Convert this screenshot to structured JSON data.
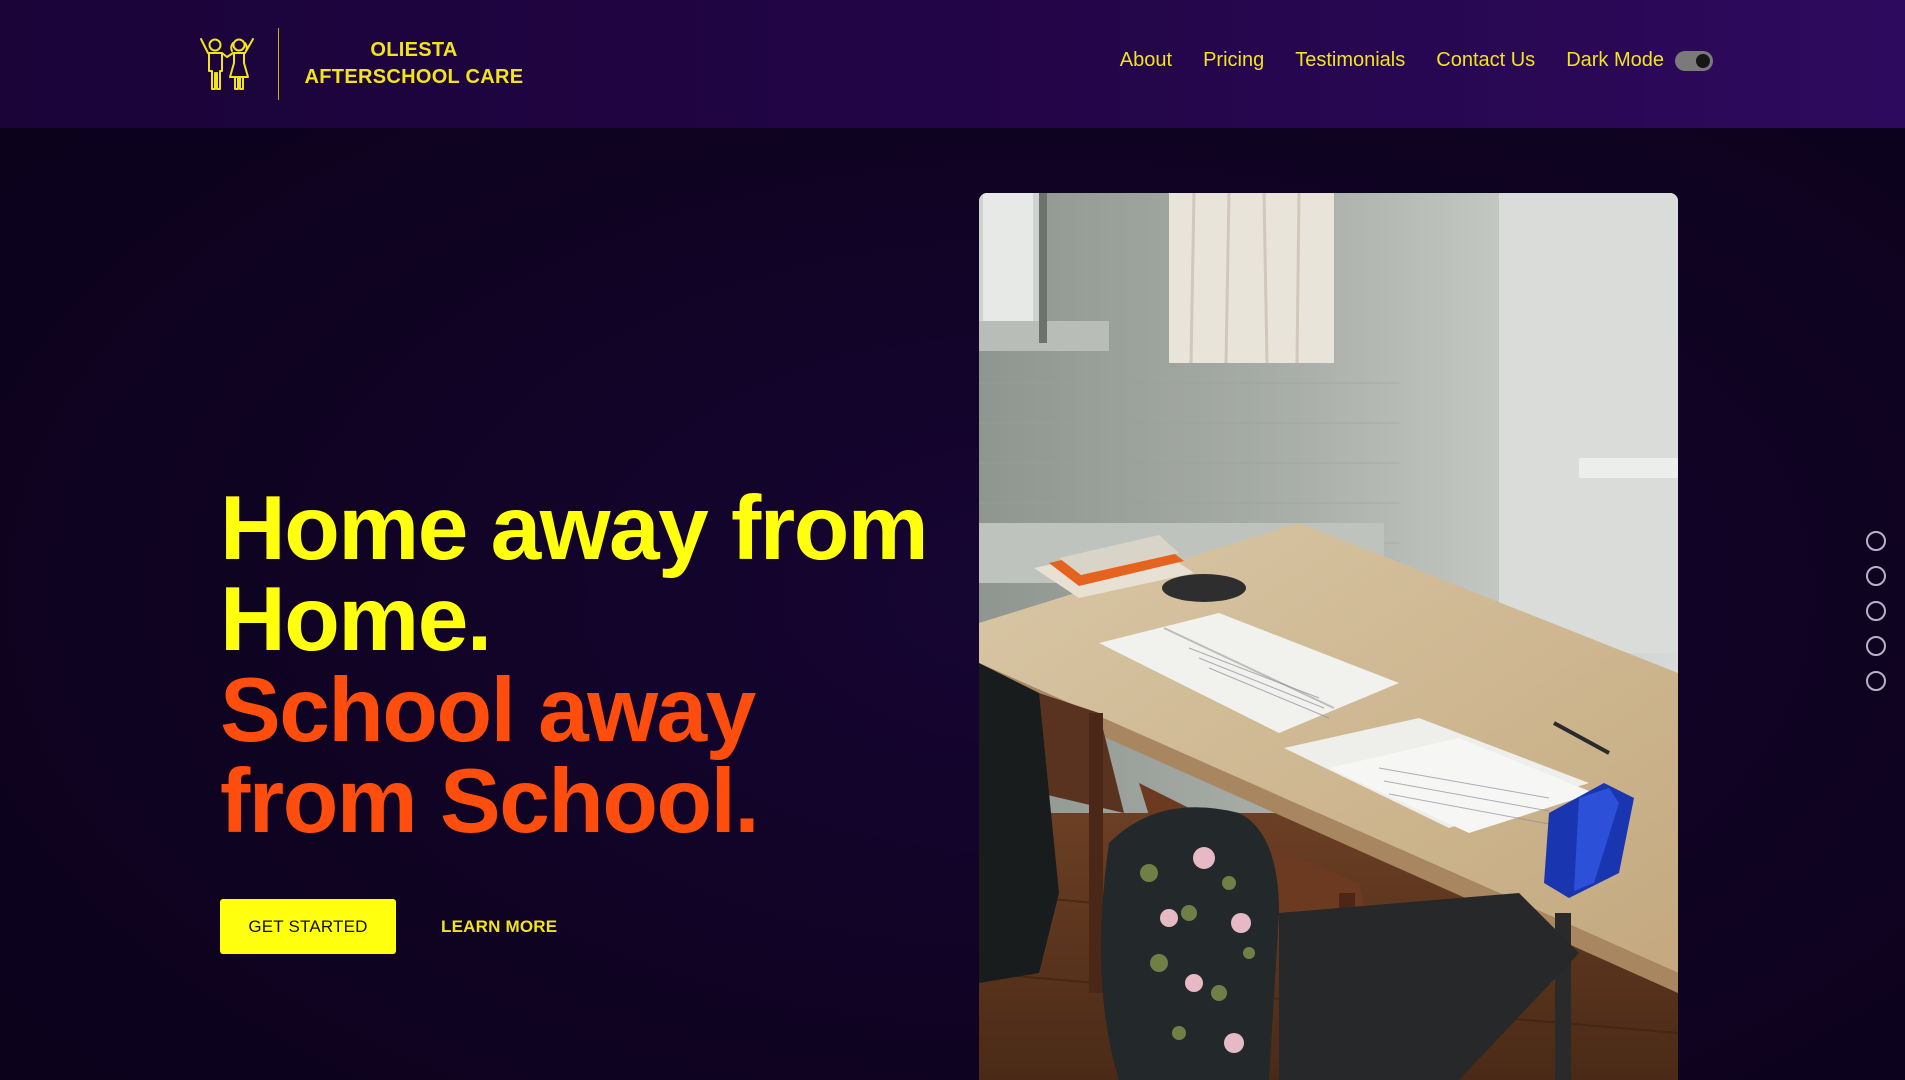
{
  "header": {
    "brand_name": "OLIESTA AFTERSCHOOL CARE",
    "logo_icon": "children-holding-hands-icon",
    "nav": [
      {
        "label": "About"
      },
      {
        "label": "Pricing"
      },
      {
        "label": "Testimonials"
      },
      {
        "label": "Contact Us"
      }
    ],
    "dark_mode_label": "Dark Mode",
    "dark_mode_on": true
  },
  "hero": {
    "headline_line1": "Home away from Home.",
    "headline_line2": "School away from School.",
    "primary_button": "GET STARTED",
    "secondary_button": "LEARN MORE",
    "image_alt": "classroom desk with notebooks, books, pencil case and backpack on chair"
  },
  "slider": {
    "dot_count": 5
  },
  "colors": {
    "accent_yellow": "#ffff0e",
    "accent_orange": "#ff4d0d",
    "background": "#0f0322",
    "header": "#230548"
  }
}
